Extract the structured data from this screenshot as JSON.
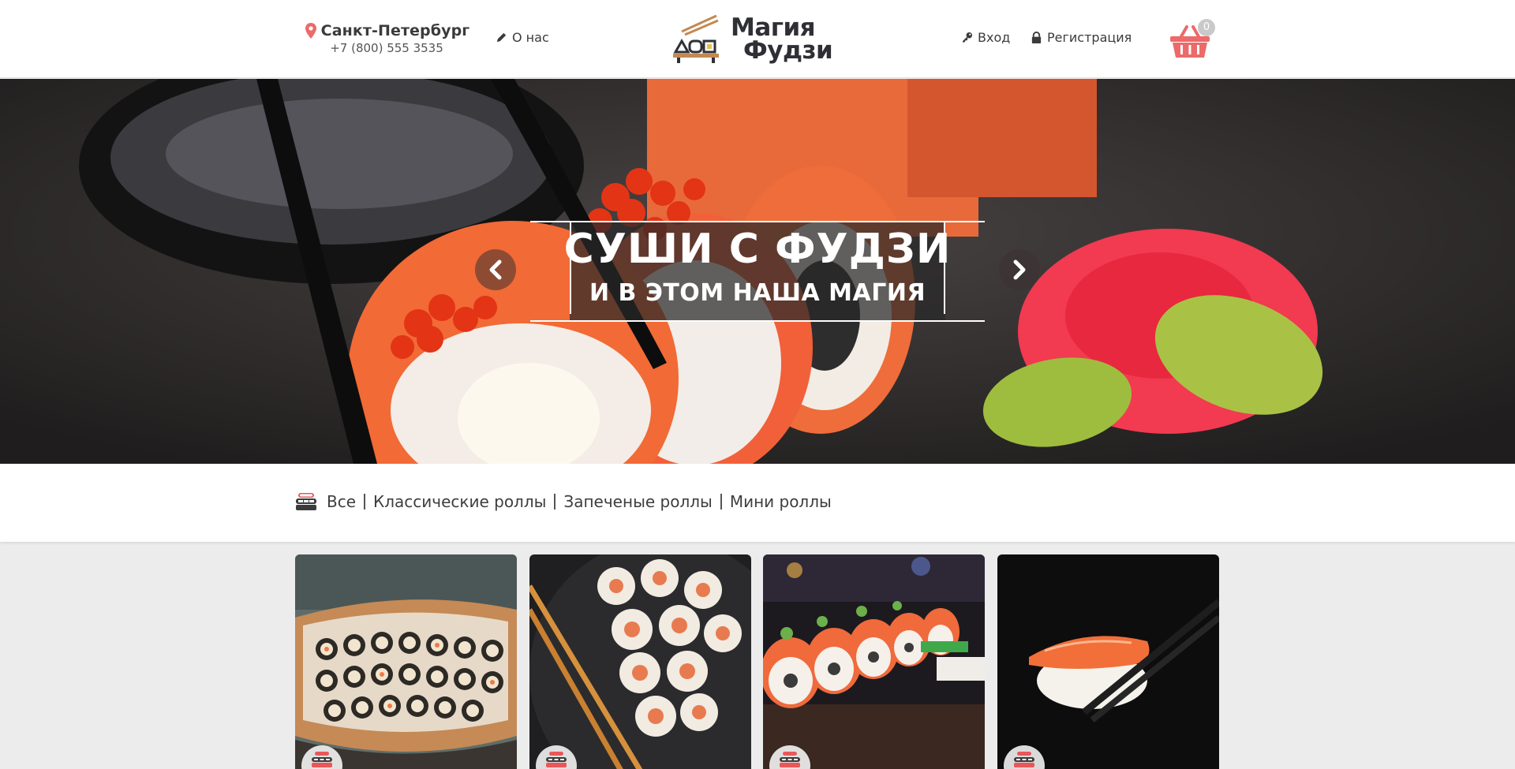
{
  "header": {
    "city": "Санкт-Петербург",
    "phone": "+7 (800) 555 3535",
    "about_label": "О нас",
    "logo_line1": "Магия",
    "logo_line2": "Фудзи",
    "login_label": "Вход",
    "register_label": "Регистрация",
    "cart_count": "0",
    "icons": [
      "map-pin-icon",
      "pencil-icon",
      "key-icon",
      "lock-icon",
      "basket-icon"
    ]
  },
  "hero": {
    "title": "СУШИ С ФУДЗИ",
    "subtitle": "И В ЭТОМ НАША МАГИЯ",
    "icons": [
      "chevron-left-icon",
      "chevron-right-icon"
    ]
  },
  "categories": {
    "items": [
      "Все",
      "Классические роллы",
      "Запеченые роллы",
      "Мини роллы"
    ],
    "icon": "sushi-icon"
  },
  "products": {
    "count": 4,
    "badge_icon": "sushi-badge-icon"
  },
  "colors": {
    "accent": "#e8585a",
    "text": "#3b3b3b",
    "background": "#ececec"
  }
}
